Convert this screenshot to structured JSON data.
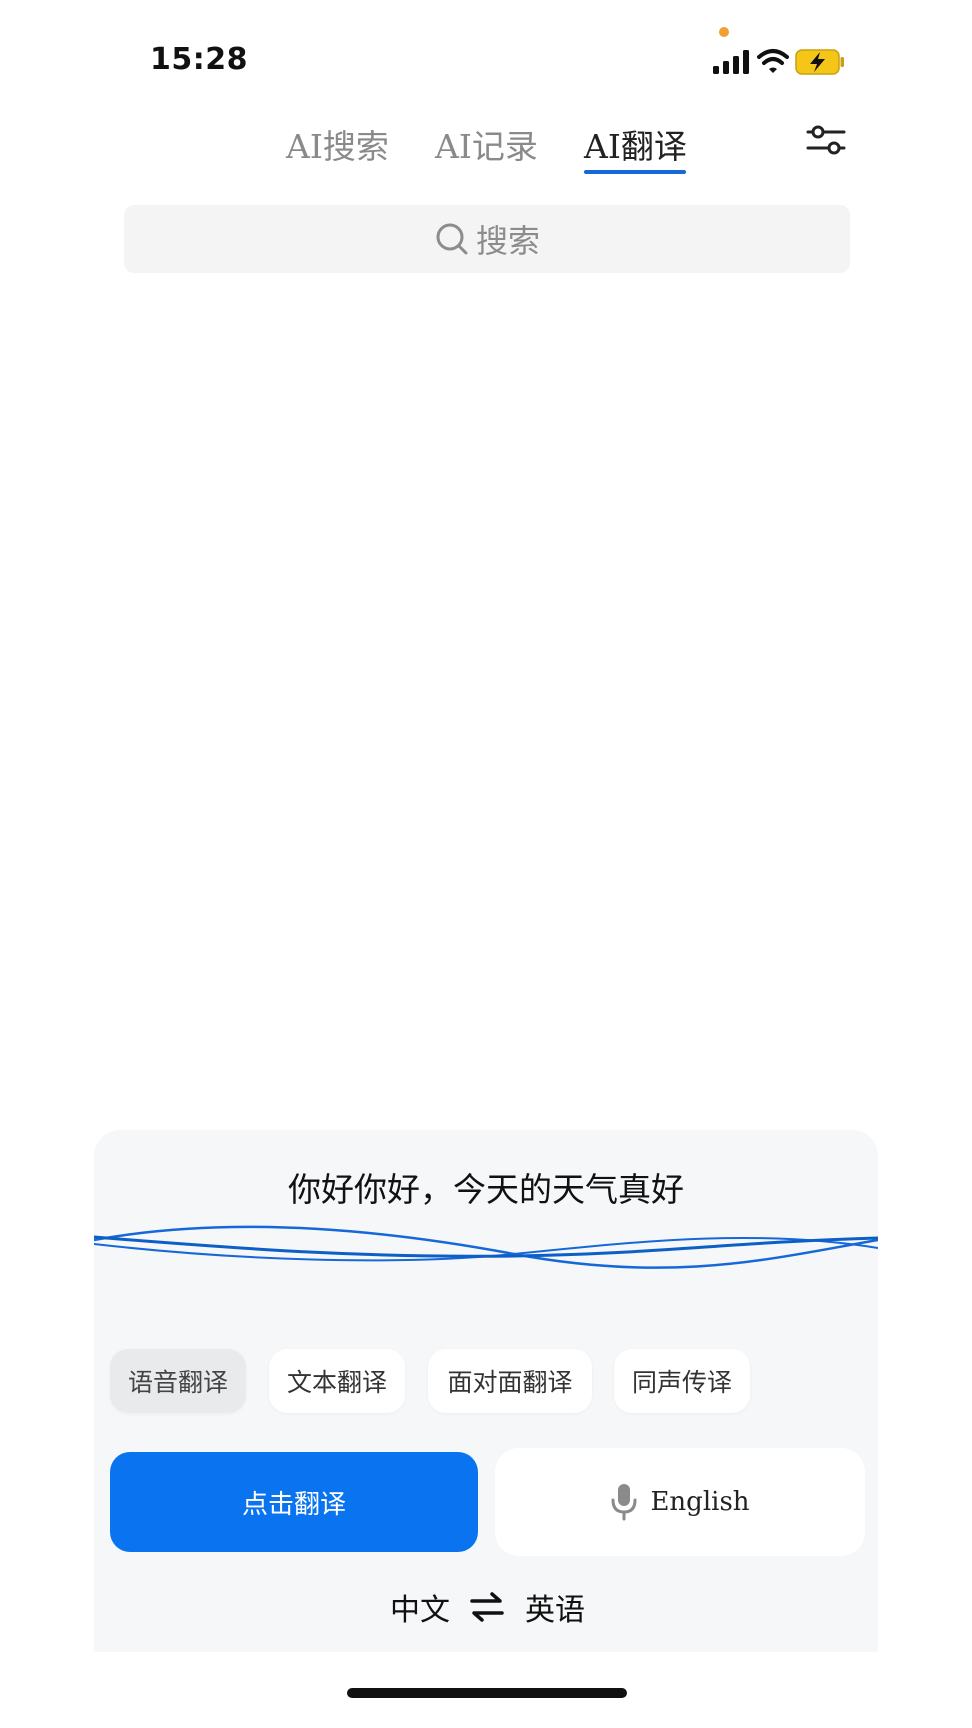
{
  "status_bar": {
    "time": "15:28",
    "icons": [
      "cellular-signal-icon",
      "wifi-icon",
      "battery-charging-icon"
    ],
    "battery_color": "#f5c518",
    "privacy_dot_color": "#f0a030"
  },
  "tabs": [
    {
      "label": "AI搜索",
      "active": false
    },
    {
      "label": "AI记录",
      "active": false
    },
    {
      "label": "AI翻译",
      "active": true
    }
  ],
  "accent_color": "#1668d8",
  "settings_icon": "sliders-icon",
  "search": {
    "placeholder": "搜索",
    "icon": "search-icon"
  },
  "transcript": {
    "text": "你好你好，今天的天气真好"
  },
  "modes": [
    {
      "label": "语音翻译",
      "selected": true
    },
    {
      "label": "文本翻译",
      "selected": false
    },
    {
      "label": "面对面翻译",
      "selected": false
    },
    {
      "label": "同声传译",
      "selected": false
    }
  ],
  "actions": {
    "translate_label": "点击翻译",
    "translate_color": "#0a74f0",
    "target_voice_label": "English",
    "target_voice_icon": "microphone-icon"
  },
  "languages": {
    "source": "中文",
    "target": "英语",
    "swap_icon": "swap-arrows-icon"
  }
}
